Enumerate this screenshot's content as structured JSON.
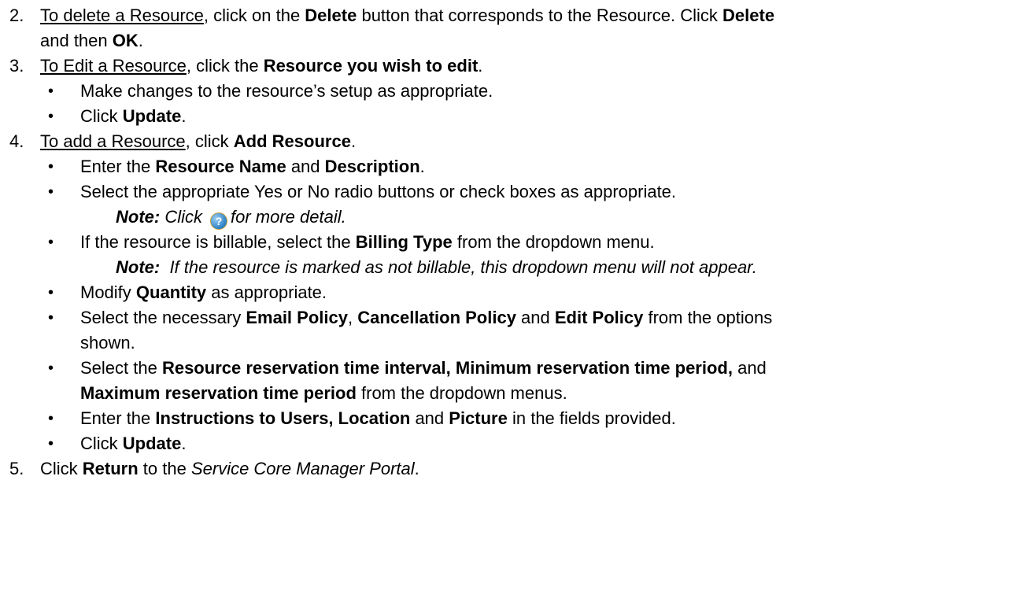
{
  "step2": {
    "num": "2.",
    "link": "To delete a Resource",
    "t1": ", click on the ",
    "b1": "Delete",
    "t2": " button that corresponds to the Resource. Click ",
    "b2": "Delete",
    "t3": "and then ",
    "b3": "OK",
    "t4": "."
  },
  "step3": {
    "num": "3.",
    "link": "To Edit a Resource",
    "t1": ", click the ",
    "b1": "Resource you wish to edit",
    "t2": ".",
    "bullets": [
      {
        "text": "Make changes to the resource’s setup as appropriate."
      },
      {
        "pre": "Click ",
        "bold": "Update",
        "post": "."
      }
    ]
  },
  "step4": {
    "num": "4.",
    "link": "To add a Resource",
    "t1": ", click ",
    "b1": "Add Resource",
    "t2": ".",
    "bullet1": {
      "pre": "Enter the ",
      "b1": "Resource Name",
      "mid": " and ",
      "b2": "Description",
      "post": "."
    },
    "bullet2": {
      "text": "Select the appropriate Yes or No radio buttons or check boxes as appropriate."
    },
    "note1": {
      "label": "Note:",
      "pre": " Click",
      "icon": "help-icon",
      "post": "for more detail."
    },
    "bullet3": {
      "pre": "If the resource is billable, select the ",
      "bold": "Billing Type",
      "post": " from the dropdown menu."
    },
    "note2": {
      "label": "Note:",
      "text": "  If the resource is marked as not billable, this dropdown menu will not appear."
    },
    "bullet4": {
      "pre": "Modify ",
      "bold": "Quantity",
      "post": " as appropriate."
    },
    "bullet5": {
      "pre": "Select the necessary ",
      "b1": "Email Policy",
      "m1": ", ",
      "b2": "Cancellation Policy",
      "m2": " and ",
      "b3": "Edit Policy",
      "post": " from the options",
      "cont": "shown."
    },
    "bullet6": {
      "pre": "Select the ",
      "b1": "Resource reservation time interval, Minimum reservation time period,",
      "m1": " and",
      "b2": "Maximum reservation time period",
      "post": " from the dropdown menus."
    },
    "bullet7": {
      "pre": "Enter the ",
      "b1": "Instructions to Users, Location",
      "m1": " and ",
      "b2": "Picture",
      "post": " in the fields provided."
    },
    "bullet8": {
      "pre": "Click ",
      "bold": "Update",
      "post": "."
    }
  },
  "step5": {
    "num": "5.",
    "pre": "Click ",
    "bold": "Return",
    "mid": " to the ",
    "italic": "Service Core Manager Portal",
    "post": "."
  }
}
